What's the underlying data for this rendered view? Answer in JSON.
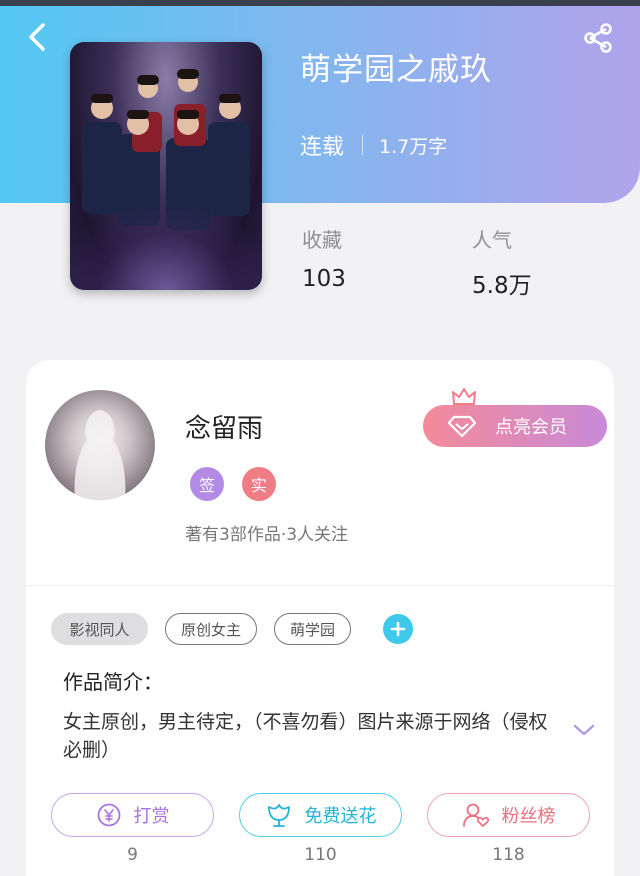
{
  "header": {
    "title": "萌学园之戚玖",
    "status": "连载",
    "word_count": "1.7万字",
    "back_icon": "chevron-left-icon",
    "share_icon": "share-icon"
  },
  "stats": [
    {
      "label": "收藏",
      "value": "103"
    },
    {
      "label": "人气",
      "value": "5.8万"
    }
  ],
  "author": {
    "name": "念留雨",
    "badges": [
      "签",
      "实"
    ],
    "meta": "著有3部作品·3人关注",
    "vip_button": "点亮会员"
  },
  "tags": [
    "影视同人",
    "原创女主",
    "萌学园"
  ],
  "intro": {
    "title": "作品简介：",
    "text": "女主原创，男主待定，（不喜勿看）图片来源于网络（侵权必删）"
  },
  "actions": [
    {
      "label": "打赏",
      "count": "9",
      "icon": "yen-coin-icon"
    },
    {
      "label": "免费送花",
      "count": "110",
      "icon": "flower-icon"
    },
    {
      "label": "粉丝榜",
      "count": "118",
      "icon": "user-heart-icon"
    }
  ],
  "colors": {
    "header_gradient_start": "#52c8f2",
    "header_gradient_end": "#b1a3ec",
    "vip_gradient_start": "#f48a98",
    "vip_gradient_end": "#c88ad8",
    "accent_cyan": "#3ec8ea",
    "reward_purple": "#a774e2",
    "fans_red": "#e9717f"
  }
}
